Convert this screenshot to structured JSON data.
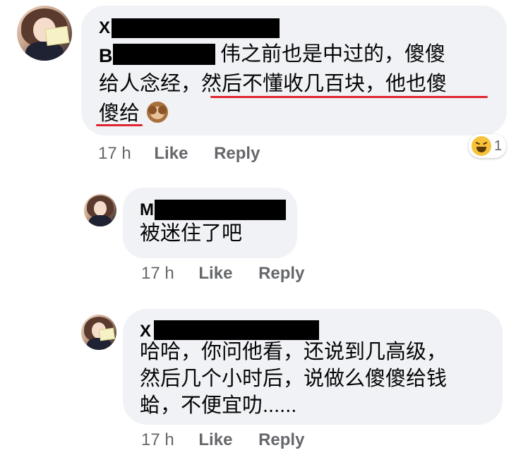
{
  "comments": [
    {
      "author_initial": "X",
      "lines": [
        {
          "after_redaction": "伟之前也是中过的，傻傻"
        },
        {
          "plain": "给人念经，",
          "underlined": "然后不懂收几百块，他也傻"
        },
        {
          "underlined": "傻给"
        }
      ],
      "lead_initial": "B",
      "emoji": "see-no-evil-monkey",
      "time": "17 h",
      "like": "Like",
      "reply": "Reply",
      "reaction": {
        "icon": "laughing-face",
        "count": "1"
      }
    },
    {
      "author_initial": "M",
      "lines": [
        "被迷住了吧"
      ],
      "time": "17 h",
      "like": "Like",
      "reply": "Reply"
    },
    {
      "author_initial": "X",
      "lines": [
        "哈哈，你问他看，还说到几高级，",
        "然后几个小时后，说做么傻傻给钱",
        "蛤，不便宜叻......"
      ],
      "time": "17 h",
      "like": "Like",
      "reply": "Reply"
    }
  ],
  "colors": {
    "bubble": "#f0f2f5",
    "meta_text": "#65676b",
    "underline": "#e0242f",
    "redaction": "#000000"
  }
}
